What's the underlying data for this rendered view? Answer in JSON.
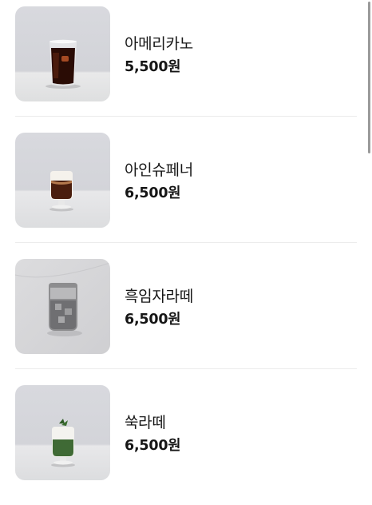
{
  "menu": {
    "items": [
      {
        "name": "아메리카노",
        "price": "5,500원",
        "image_icon": "iced-americano-photo"
      },
      {
        "name": "아인슈페너",
        "price": "6,500원",
        "image_icon": "einspanner-photo"
      },
      {
        "name": "흑임자라떼",
        "price": "6,500원",
        "image_icon": "black-sesame-latte-photo"
      },
      {
        "name": "쑥라떼",
        "price": "6,500원",
        "image_icon": "mugwort-latte-photo"
      }
    ]
  },
  "colors": {
    "text": "#161616",
    "divider": "#ececec",
    "thumb_bg": "#d6d7dc"
  }
}
